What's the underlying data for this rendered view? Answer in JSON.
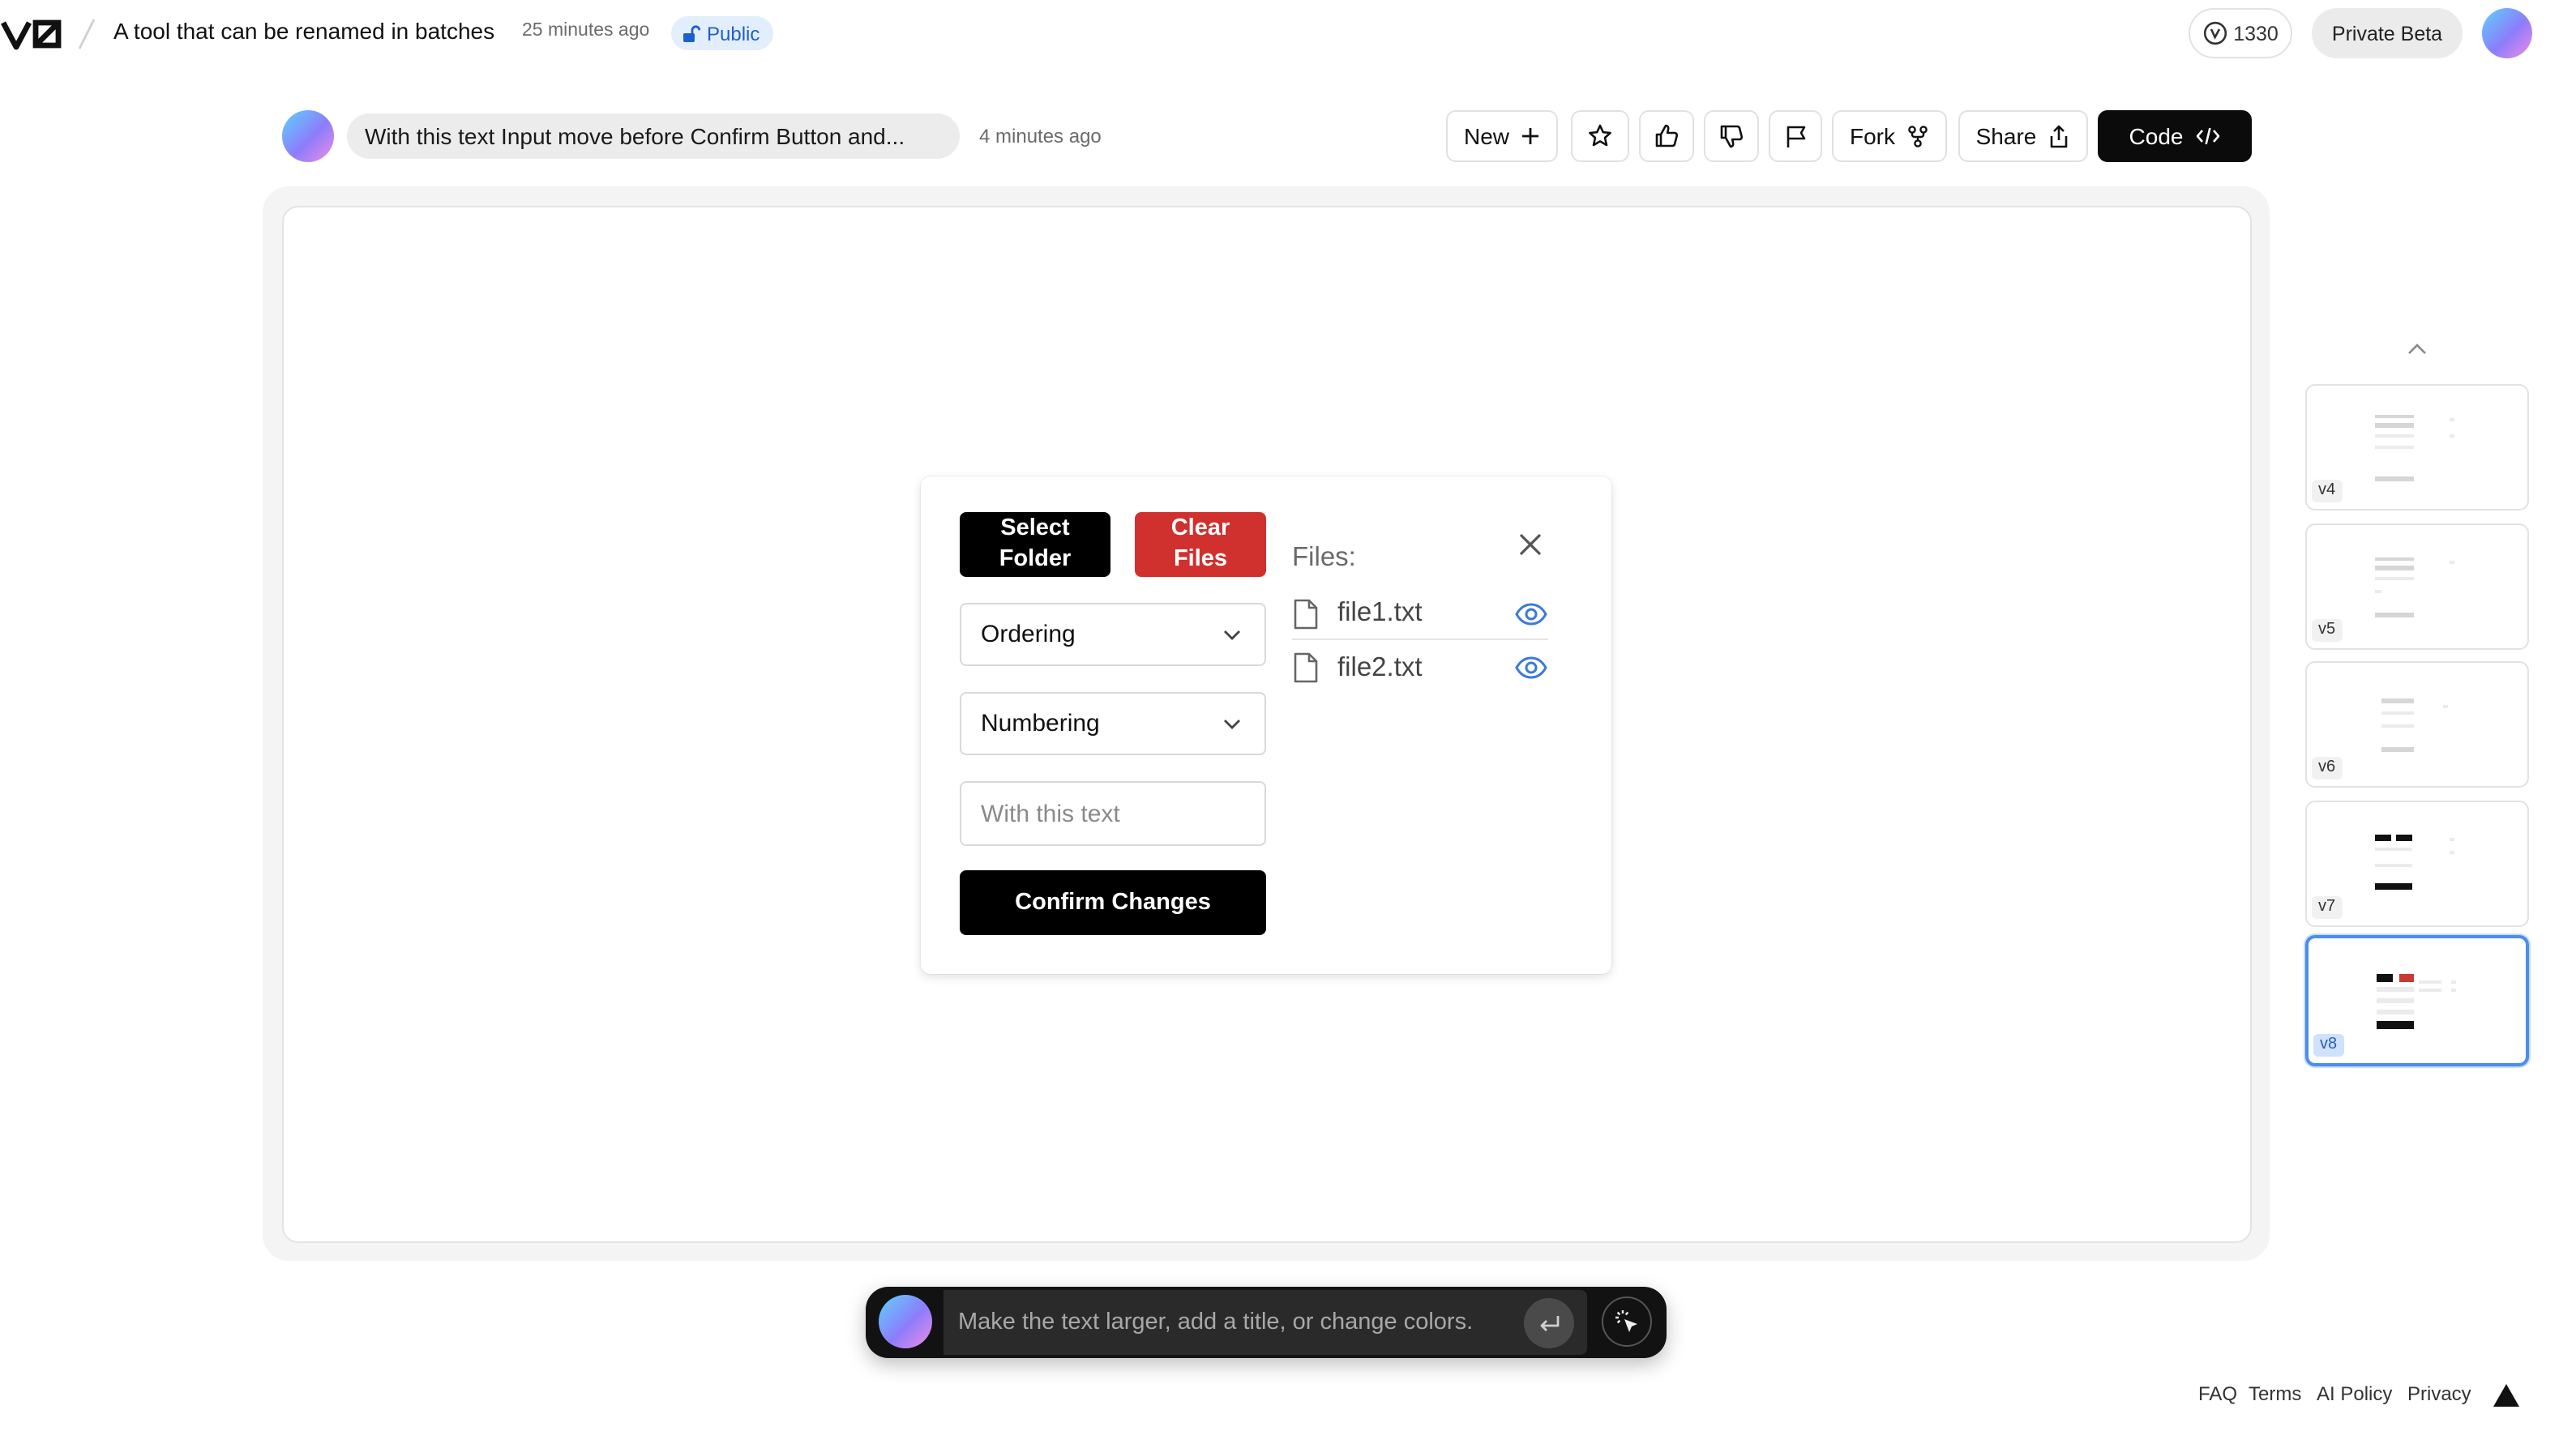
{
  "app": {
    "project_title": "A tool that can be renamed in batches",
    "updated": "25 minutes ago",
    "visibility": "Public",
    "credits": "1330",
    "beta_label": "Private Beta"
  },
  "message": {
    "text": "With this text Input move before Confirm Button and...",
    "time": "4 minutes ago"
  },
  "toolbar": {
    "new_label": "New",
    "fork_label": "Fork",
    "share_label": "Share",
    "code_label": "Code"
  },
  "preview": {
    "select_folder_line1": "Select",
    "select_folder_line2": "Folder",
    "clear_files_line1": "Clear",
    "clear_files_line2": "Files",
    "ordering": "Ordering",
    "numbering": "Numbering",
    "text_placeholder": "With this text",
    "confirm_label": "Confirm Changes",
    "files_label": "Files:",
    "files": [
      "file1.txt",
      "file2.txt"
    ],
    "accent_color": "#d0302e",
    "link_color": "#3b7ad9"
  },
  "versions": [
    "v4",
    "v5",
    "v6",
    "v7",
    "v8"
  ],
  "active_version": "v8",
  "prompt": {
    "placeholder": "Make the text larger, add a title, or change colors."
  },
  "footer": {
    "faq": "FAQ",
    "terms": "Terms",
    "ai_policy": "AI Policy",
    "privacy": "Privacy"
  }
}
